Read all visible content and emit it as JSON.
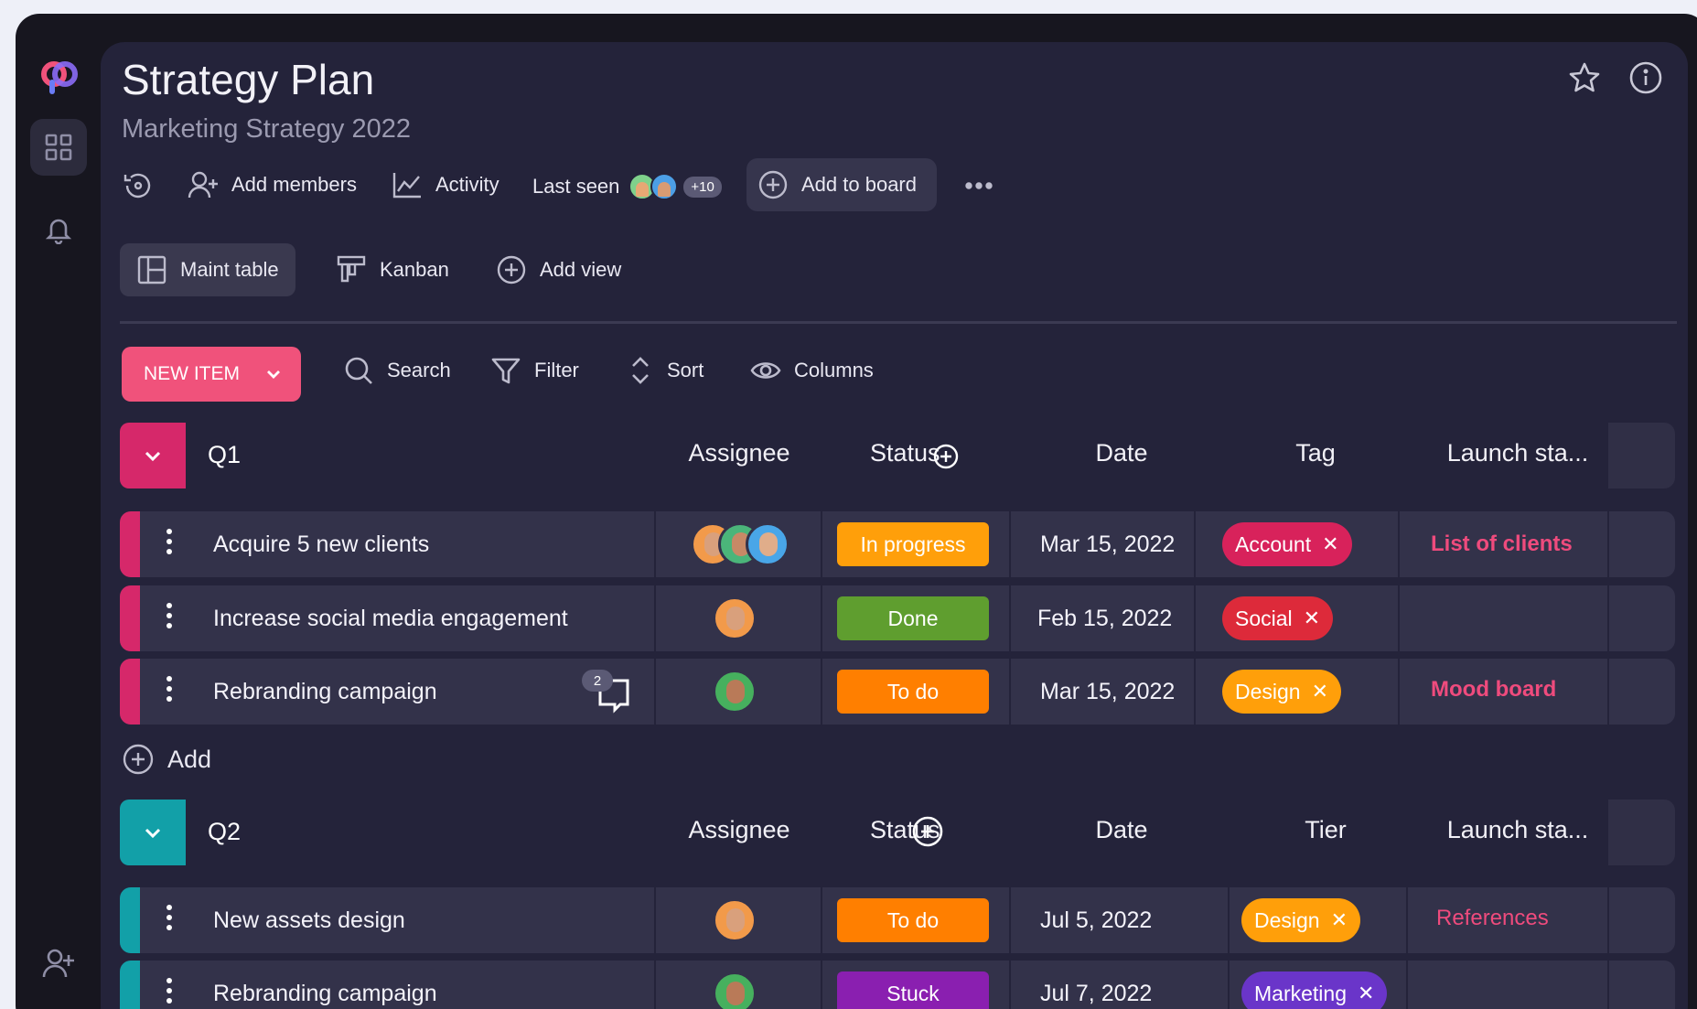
{
  "header": {
    "title": "Strategy Plan",
    "subtitle": "Marketing Strategy 2022"
  },
  "toolbar": {
    "add_members": "Add members",
    "activity": "Activity",
    "last_seen": "Last seen",
    "last_seen_extra": "+10",
    "add_to_board": "Add to board"
  },
  "views": {
    "maint_table": "Maint table",
    "kanban": "Kanban",
    "add_view": "Add view"
  },
  "actions": {
    "new_item": "NEW ITEM",
    "search": "Search",
    "filter": "Filter",
    "sort": "Sort",
    "columns": "Columns",
    "add": "Add"
  },
  "groups": [
    {
      "name": "Q1",
      "color": "#d6286a",
      "columns": [
        "Assignee",
        "Status",
        "Date",
        "Tag",
        "Launch sta..."
      ],
      "rows": [
        {
          "name": "Acquire 5 new clients",
          "status": "In progress",
          "status_color": "#ff9f0a",
          "date": "Mar 15, 2022",
          "tag": "Account",
          "tag_color": "#d8225b",
          "launch": "List of clients"
        },
        {
          "name": "Increase social media engagement",
          "status": "Done",
          "status_color": "#5f9e2f",
          "date": "Feb 15, 2022",
          "tag": "Social",
          "tag_color": "#dd2a3a",
          "launch": ""
        },
        {
          "name": "Rebranding campaign",
          "comments": "2",
          "status": "To do",
          "status_color": "#ff7f00",
          "date": "Mar 15, 2022",
          "tag": "Design",
          "tag_color": "#ff9f0a",
          "launch": "Mood board"
        }
      ]
    },
    {
      "name": "Q2",
      "color": "#12a0a8",
      "columns": [
        "Assignee",
        "Status",
        "Date",
        "Tier",
        "Launch sta..."
      ],
      "rows": [
        {
          "name": "New assets design",
          "status": "To do",
          "status_color": "#ff7f00",
          "date": "Jul 5, 2022",
          "tag": "Design",
          "tag_color": "#ff9f0a",
          "launch": "References"
        },
        {
          "name": "Rebranding campaign",
          "status": "Stuck",
          "status_color": "#8a1fb0",
          "date": "Jul 7, 2022",
          "tag": "Marketing",
          "tag_color": "#6a35c9",
          "launch": ""
        }
      ]
    }
  ]
}
